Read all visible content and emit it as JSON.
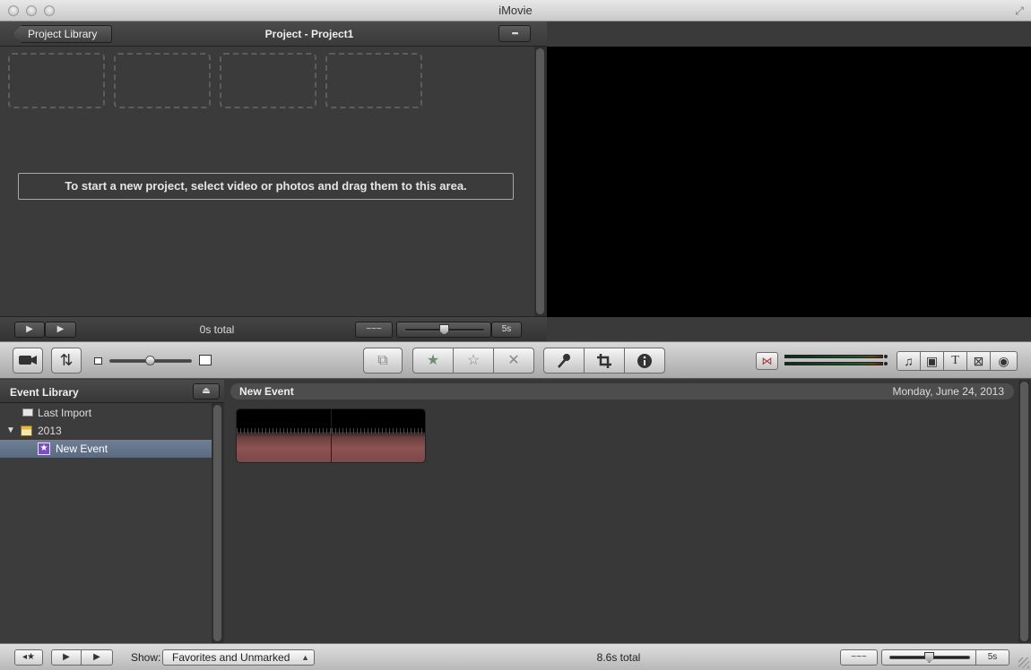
{
  "window": {
    "title": "iMovie"
  },
  "project": {
    "back_button": "Project Library",
    "title": "Project - Project1",
    "view_button": "▪▪▪",
    "drop_message": "To start a new project, select video or photos and drag them to this area.",
    "total": "0s total",
    "duration": "5s",
    "audio_label": "~~~"
  },
  "toolbar": {
    "camera_icon": "camera-icon",
    "swap_icon": "swap-icon",
    "favorite": "★",
    "unmark": "☆",
    "reject": "✕",
    "voiceover": "🎤",
    "crop": "⌗",
    "info": "ℹ",
    "music": "♫",
    "photo": "▣",
    "title": "T",
    "transition": "⊠",
    "map": "◉",
    "audio_adjust": "⋈"
  },
  "event_library": {
    "title": "Event Library",
    "eject": "⏏",
    "items": [
      {
        "label": "Last Import"
      },
      {
        "label": "2013",
        "disclosure": "▼"
      },
      {
        "label": "New Event",
        "selected": true
      }
    ]
  },
  "event_browser": {
    "event_title": "New Event",
    "event_date": "Monday, June 24, 2013"
  },
  "bottom": {
    "show_label": "Show:",
    "show_value": "Favorites and Unmarked",
    "total": "8.6s total",
    "duration": "5s",
    "audio_label": "~~~"
  }
}
